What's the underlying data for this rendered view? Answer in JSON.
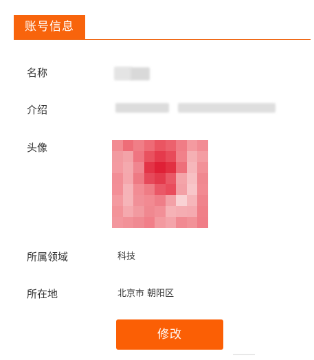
{
  "header": {
    "tab_label": "账号信息"
  },
  "fields": {
    "name_label": "名称",
    "intro_label": "介绍",
    "avatar_label": "头像",
    "category_label": "所属领域",
    "category_value": "科技",
    "location_label": "所在地",
    "location_value": "北京市 朝阳区"
  },
  "actions": {
    "edit_label": "修改"
  },
  "colors": {
    "accent": "#f8640c",
    "avatar_tint": "#f0808a"
  },
  "icons": [
    "blurred-avatar-image"
  ]
}
